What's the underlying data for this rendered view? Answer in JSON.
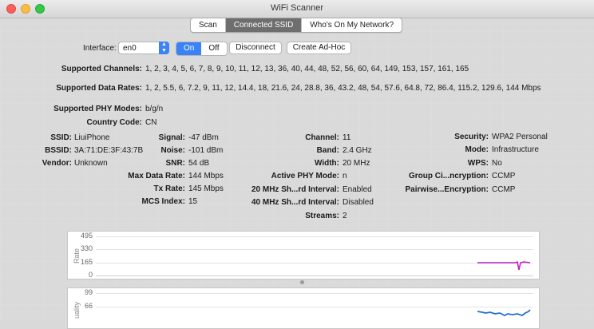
{
  "window": {
    "title": "WiFi Scanner"
  },
  "tabs": [
    {
      "label": "Scan",
      "selected": false
    },
    {
      "label": "Connected SSID",
      "selected": true
    },
    {
      "label": "Who's On My Network?",
      "selected": false
    }
  ],
  "toolbar": {
    "interface_label": "Interface:",
    "interface_value": "en0",
    "on_label": "On",
    "off_label": "Off",
    "disconnect_label": "Disconnect",
    "adhoc_label": "Create Ad-Hoc"
  },
  "capabilities": {
    "channels_label": "Supported Channels:",
    "channels_value": "1, 2, 3, 4, 5, 6, 7, 8, 9, 10, 11, 12, 13, 36, 40, 44, 48, 52, 56, 60, 64, 149, 153, 157, 161, 165",
    "rates_label": "Supported Data Rates:",
    "rates_value": "1, 2, 5.5, 6, 7.2, 9, 11, 12, 14.4, 18, 21.6, 24, 28.8, 36, 43.2, 48, 54, 57.6, 64.8, 72, 86.4, 115.2, 129.6, 144 Mbps",
    "phy_label": "Supported PHY Modes:",
    "phy_value": "b/g/n",
    "country_label": "Country Code:",
    "country_value": "CN"
  },
  "details": {
    "ssid_label": "SSID:",
    "ssid": "LiuiPhone",
    "bssid_label": "BSSID:",
    "bssid": "3A:71:DE:3F:43:7B",
    "vendor_label": "Vendor:",
    "vendor": "Unknown",
    "signal_label": "Signal:",
    "signal": "-47 dBm",
    "noise_label": "Noise:",
    "noise": "-101 dBm",
    "snr_label": "SNR:",
    "snr": "54 dB",
    "maxrate_label": "Max Data Rate:",
    "maxrate": "144 Mbps",
    "txrate_label": "Tx Rate:",
    "txrate": "145 Mbps",
    "mcs_label": "MCS Index:",
    "mcs": "15",
    "channel_label": "Channel:",
    "channel": "11",
    "band_label": "Band:",
    "band": "2.4 GHz",
    "width_label": "Width:",
    "width": "20 MHz",
    "phymode_label": "Active PHY Mode:",
    "phymode": "n",
    "gi20_label": "20 MHz Sh...rd Interval:",
    "gi20": "Enabled",
    "gi40_label": "40 MHz Sh...rd Interval:",
    "gi40": "Disabled",
    "streams_label": "Streams:",
    "streams": "2",
    "security_label": "Security:",
    "security": "WPA2 Personal",
    "mode_label": "Mode:",
    "mode": "Infrastructure",
    "wps_label": "WPS:",
    "wps": "No",
    "group_label": "Group Ci...ncryption:",
    "group": "CCMP",
    "pairwise_label": "Pairwise...Encryption:",
    "pairwise": "CCMP"
  },
  "rate_chart": {
    "ylabel": "Rate",
    "ticks": [
      "495",
      "330",
      "165",
      "0"
    ],
    "line_color": "#c020c8"
  },
  "quality_chart": {
    "ylabel": "uality",
    "ticks": [
      "99",
      "66"
    ],
    "line_color": "#1e6fd0"
  }
}
